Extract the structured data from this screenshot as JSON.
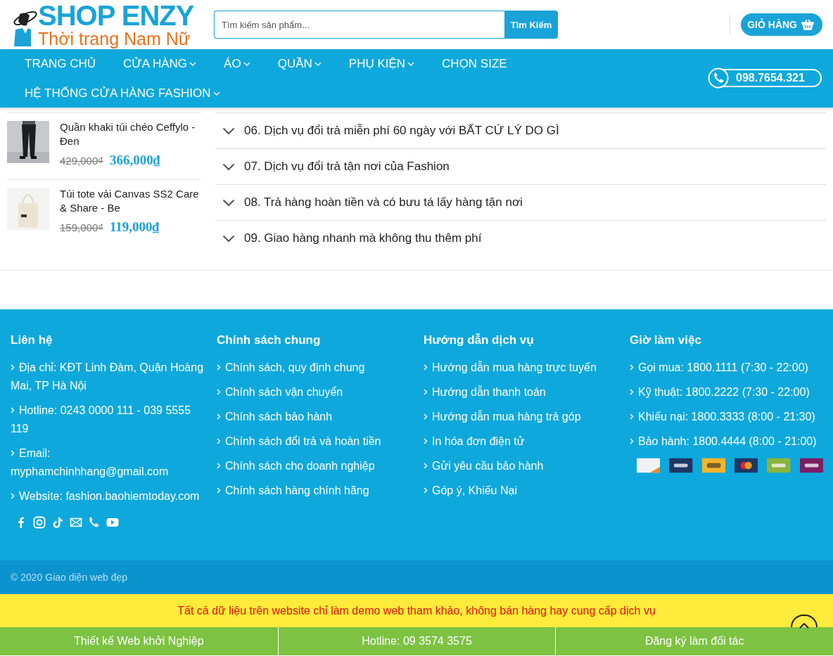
{
  "header": {
    "logo_title": "SHOP ENZY",
    "logo_subtitle": "Thời trang Nam Nữ",
    "search": {
      "placeholder": "Tìm kiếm sản phẩm...",
      "button": "Tìm Kiếm"
    },
    "cart": "GIỎ HÀNG"
  },
  "nav": {
    "items": [
      {
        "label": "TRANG CHỦ",
        "dropdown": false
      },
      {
        "label": "CỬA HÀNG",
        "dropdown": true
      },
      {
        "label": "ÁO",
        "dropdown": true
      },
      {
        "label": "QUẦN",
        "dropdown": true
      },
      {
        "label": "PHỤ KIỆN",
        "dropdown": true
      },
      {
        "label": "CHỌN SIZE",
        "dropdown": false
      },
      {
        "label": "HỆ THỐNG CỬA HÀNG FASHION",
        "dropdown": true
      }
    ],
    "phone": "098.7654.321"
  },
  "products": [
    {
      "name": "Quần khaki túi chéo Ceffylo - Đen",
      "old_price": "429,000₫",
      "price": "366,000₫",
      "kind": "trousers"
    },
    {
      "name": "Túi tote vải Canvas SS2 Care & Share - Be",
      "old_price": "159,000₫",
      "price": "119,000₫",
      "kind": "bag"
    }
  ],
  "faq": [
    {
      "title": "06. Dịch vụ đổi trả miễn phí 60 ngày với BẤT CỨ LÝ DO GÌ",
      "expanded": false
    },
    {
      "title": "07. Dịch vụ đổi trả tận nơi của Fashion",
      "expanded": false
    },
    {
      "title": "08. Trả hàng hoàn tiền và có bưu tá lấy hàng tận nơi",
      "expanded": false
    },
    {
      "title": "09. Giao hàng nhanh mà không thu thêm phí",
      "expanded": false
    }
  ],
  "footer": {
    "columns": [
      {
        "title": "Liên hệ",
        "items": [
          "Địa chỉ: KĐT Linh Đàm, Quận Hoàng Mai, TP Hà Nội",
          "Hotline: 0243 0000 111 - 039 5555 119",
          "Email: myphamchinhhang@gmail.com",
          "Website: fashion.baohiemtoday.com"
        ]
      },
      {
        "title": "Chính sách chung",
        "items": [
          "Chính sách, quy định chung",
          "Chính sách vận chuyển",
          "Chính sách bảo hành",
          "Chính sách đổi trả và hoàn tiền",
          "Chính sách cho doanh nghiệp",
          "Chính sách hàng chính hãng"
        ]
      },
      {
        "title": "Hướng dẫn dịch vụ",
        "items": [
          "Hướng dẫn mua hàng trực tuyến",
          "Hướng dẫn thanh toán",
          "Hướng dẫn mua hàng trả góp",
          "In hóa đơn điện tử",
          "Gửi yêu cầu bảo hành",
          "Góp ý, Khiếu Nại"
        ]
      },
      {
        "title": "Giờ làm việc",
        "items": [
          "Gọi mua: 1800.1111 (7:30 - 22:00)",
          "Kỹ thuật: 1800.2222 (7:30 - 22:00)",
          "Khiếu nại: 1800.3333 (8:00 - 21:30)",
          "Bảo hành: 1800.4444 (8:00 - 21:00)"
        ]
      }
    ],
    "social": [
      {
        "kind": "facebook"
      },
      {
        "kind": "instagram"
      },
      {
        "kind": "tiktok"
      },
      {
        "kind": "email"
      },
      {
        "kind": "phone"
      },
      {
        "kind": "youtube"
      }
    ],
    "payments": [
      {
        "kind": "discover",
        "color": "#f2f2f2"
      },
      {
        "kind": "paypal",
        "color": "#1e3764"
      },
      {
        "kind": "echeck",
        "color": "#f5b52e"
      },
      {
        "kind": "mastercard",
        "color": "#1e3764"
      },
      {
        "kind": "shopify",
        "color": "#8bb43c"
      },
      {
        "kind": "skrill",
        "color": "#7a1f64"
      }
    ],
    "copyright": "© 2020 Giao diện web đẹp"
  },
  "notice": "Tất cả dữ liệu trên website chỉ làm demo web tham khảo, không bán hàng hay cung cấp dịch vụ",
  "bottom_bar": [
    "Thiết kế Web khởi Nghiệp",
    "Hotline: 09 3574 3575",
    "Đăng ký làm đối tác"
  ]
}
